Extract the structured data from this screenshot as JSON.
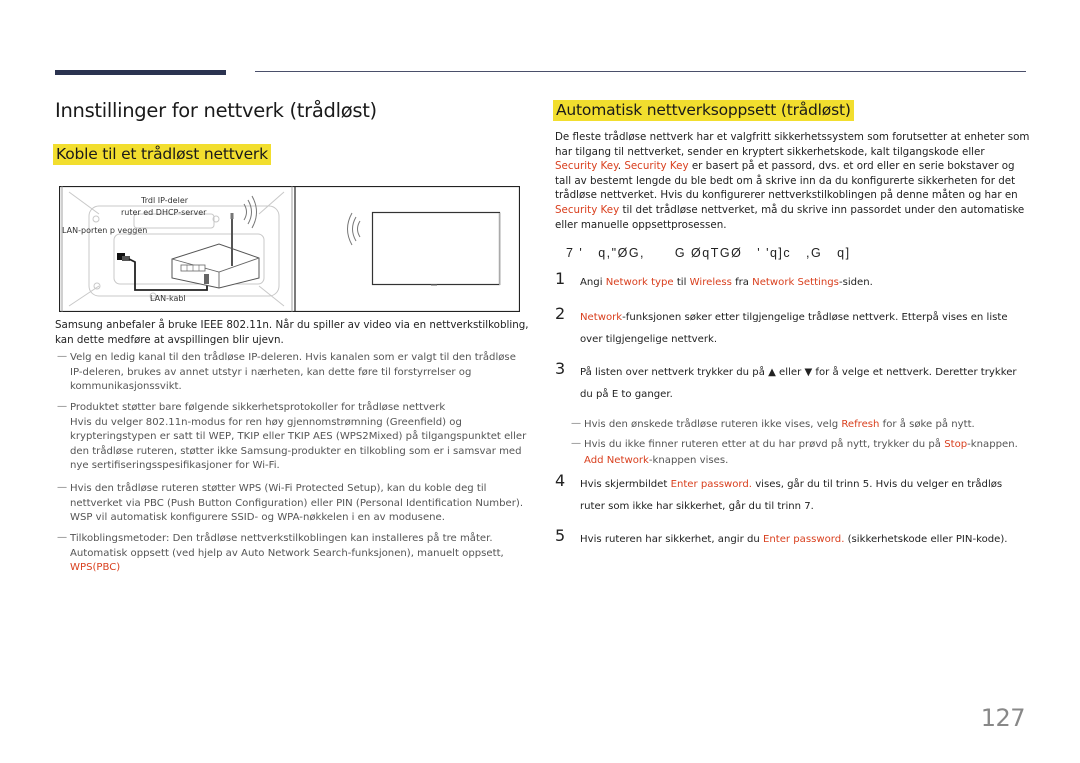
{
  "page": {
    "title": "Innstillinger for nettverk (trådløst)",
    "page_number": "127",
    "accent_highlight": "#f2de2e",
    "accent_link": "#d9401f"
  },
  "left": {
    "heading": "Koble til et trådløst nettverk",
    "diagram": {
      "label_router_line1": "Trdl IP-deler",
      "label_router_line2": "ruter ed DHCP-server",
      "label_wall_port": "LAN-porten p veggen",
      "label_cable": "LAN-kabl"
    },
    "intro": "Samsung anbefaler å bruke IEEE 802.11n. Når du spiller av video via en nettverkstilkobling, kan dette medføre at avspillingen blir ujevn.",
    "notes": [
      {
        "text": "Velg en ledig kanal til den trådløse IP-deleren. Hvis kanalen som er valgt til den trådløse IP-deleren, brukes av annet utstyr i nærheten, kan dette føre til forstyrrelser og kommunikasjonssvikt."
      },
      {
        "text": "Produktet støtter bare følgende sikkerhetsprotokoller for trådløse nettverk",
        "extra": "Hvis du velger 802.11n-modus for ren høy gjennomstrømning (Greenfield) og krypteringstypen er satt til WEP, TKIP eller TKIP AES (WPS2Mixed) på tilgangspunktet eller den trådløse ruteren, støtter ikke Samsung-produkter en tilkobling som er i samsvar med nye sertifiseringsspesifikasjoner for Wi-Fi."
      },
      {
        "text": "Hvis den trådløse ruteren støtter WPS (Wi-Fi Protected Setup), kan du koble deg til nettverket via PBC (Push Button Configuration) eller PIN (Personal Identification Number). WSP vil automatisk konfigurere SSID- og WPA-nøkkelen i en av modusene."
      },
      {
        "text": "Tilkoblingsmetoder: Den trådløse nettverkstilkoblingen kan installeres på tre måter. Automatisk oppsett (ved hjelp av Auto Network Search-funksjonen), manuelt oppsett,",
        "link": "WPS(PBC)"
      }
    ]
  },
  "right": {
    "heading": "Automatisk nettverksoppsett (trådløst)",
    "intro": {
      "p1": "De fleste trådløse nettverk har et valgfritt sikkerhetssystem som forutsetter at enheter som har tilgang til nettverket, sender en kryptert sikkerhetskode, kalt tilgangskode eller ",
      "link1": "Security Key",
      "p2": ". ",
      "link2": "Security Key",
      "p3": " er basert på et passord, dvs. et ord eller en serie bokstaver og tall av bestemt lengde du ble bedt om å skrive inn da du konfigurerte sikkerheten for det trådløse nettverket. Hvis du konfigurerer nettverkstilkoblingen på denne måten og har en ",
      "link3": "Security Key",
      "p4": " til det trådløse nettverket, må du skrive inn passordet under den automatiske eller manuelle oppsettprosessen."
    },
    "garbled_heading": "7 '   q,\"ØG,      G ØqTGØ   ' 'q]c   ,G   q]",
    "steps": [
      {
        "num": "1",
        "a": "Angi ",
        "l1": "Network type",
        "b": " til ",
        "l2": "Wireless",
        "c": " fra ",
        "l3": "Network Settings",
        "d": "-siden."
      },
      {
        "num": "2",
        "l1": "Network",
        "a": "-funksjonen søker etter tilgjengelige trådløse nettverk. Etterpå vises en liste over tilgjengelige nettverk."
      },
      {
        "num": "3",
        "a": "På listen over nettverk trykker du på ▲ eller ▼ for å velge et nettverk. Deretter trykker du på E    to ganger."
      },
      {
        "num": "4",
        "a": "Hvis skjermbildet ",
        "l1": "Enter password.",
        "b": " vises, går du til trinn 5. Hvis du velger en trådløs ruter som ikke har sikkerhet, går du til trinn 7."
      },
      {
        "num": "5",
        "a": "Hvis ruteren har sikkerhet, angir du ",
        "l1": "Enter password.",
        "b": " (sikkerhetskode eller PIN-kode)."
      }
    ],
    "step3_notes": [
      {
        "a": "Hvis den ønskede trådløse ruteren ikke vises, velg ",
        "l1": "Refresh",
        "b": " for å søke på nytt."
      },
      {
        "a": "Hvis du ikke finner ruteren etter at du har prøvd på nytt, trykker du på ",
        "l1": "Stop",
        "b": "-knappen. ",
        "l2": "Add Network",
        "c": "-knappen vises."
      }
    ]
  }
}
